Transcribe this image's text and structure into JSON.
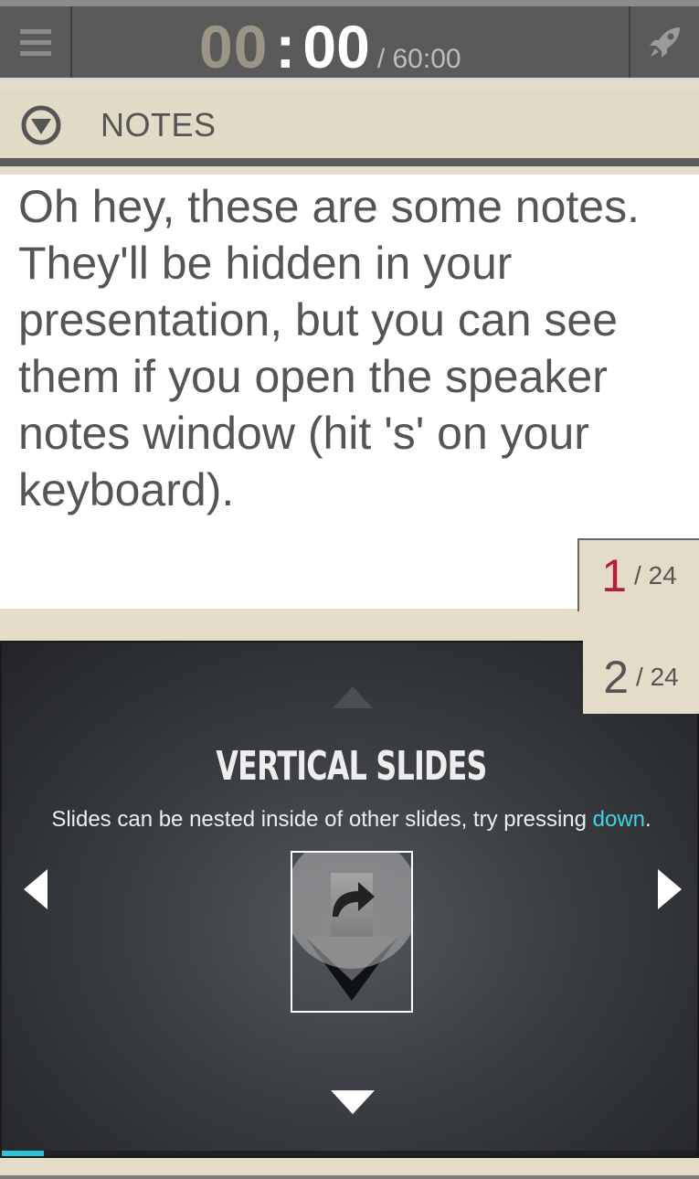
{
  "timer": {
    "minutes": "00",
    "separator": ":",
    "seconds": "00",
    "total": "/ 60:00"
  },
  "toolbar": {
    "menu_icon": "hamburger-menu-icon",
    "rocket_icon": "rocket-icon"
  },
  "notes": {
    "toggle_icon": "collapse-circle-icon",
    "label": "NOTES",
    "text": "Oh hey, these are some notes. They'll be hidden in your presentation, but you can see them if you open the speaker notes window (hit 's' on your keyboard)."
  },
  "current_slide": {
    "number": "1",
    "of_total": "/ 24",
    "number_color": "#b41f3a"
  },
  "upcoming_slide": {
    "number": "2",
    "of_total": "/ 24",
    "number_color": "#555555",
    "title": "VERTICAL SLIDES",
    "subtitle_before": "Slides can be nested inside of other slides, try pressing ",
    "subtitle_link": "down",
    "subtitle_after": ".",
    "progress": 0.06,
    "accent_color": "#2bc4d6"
  }
}
